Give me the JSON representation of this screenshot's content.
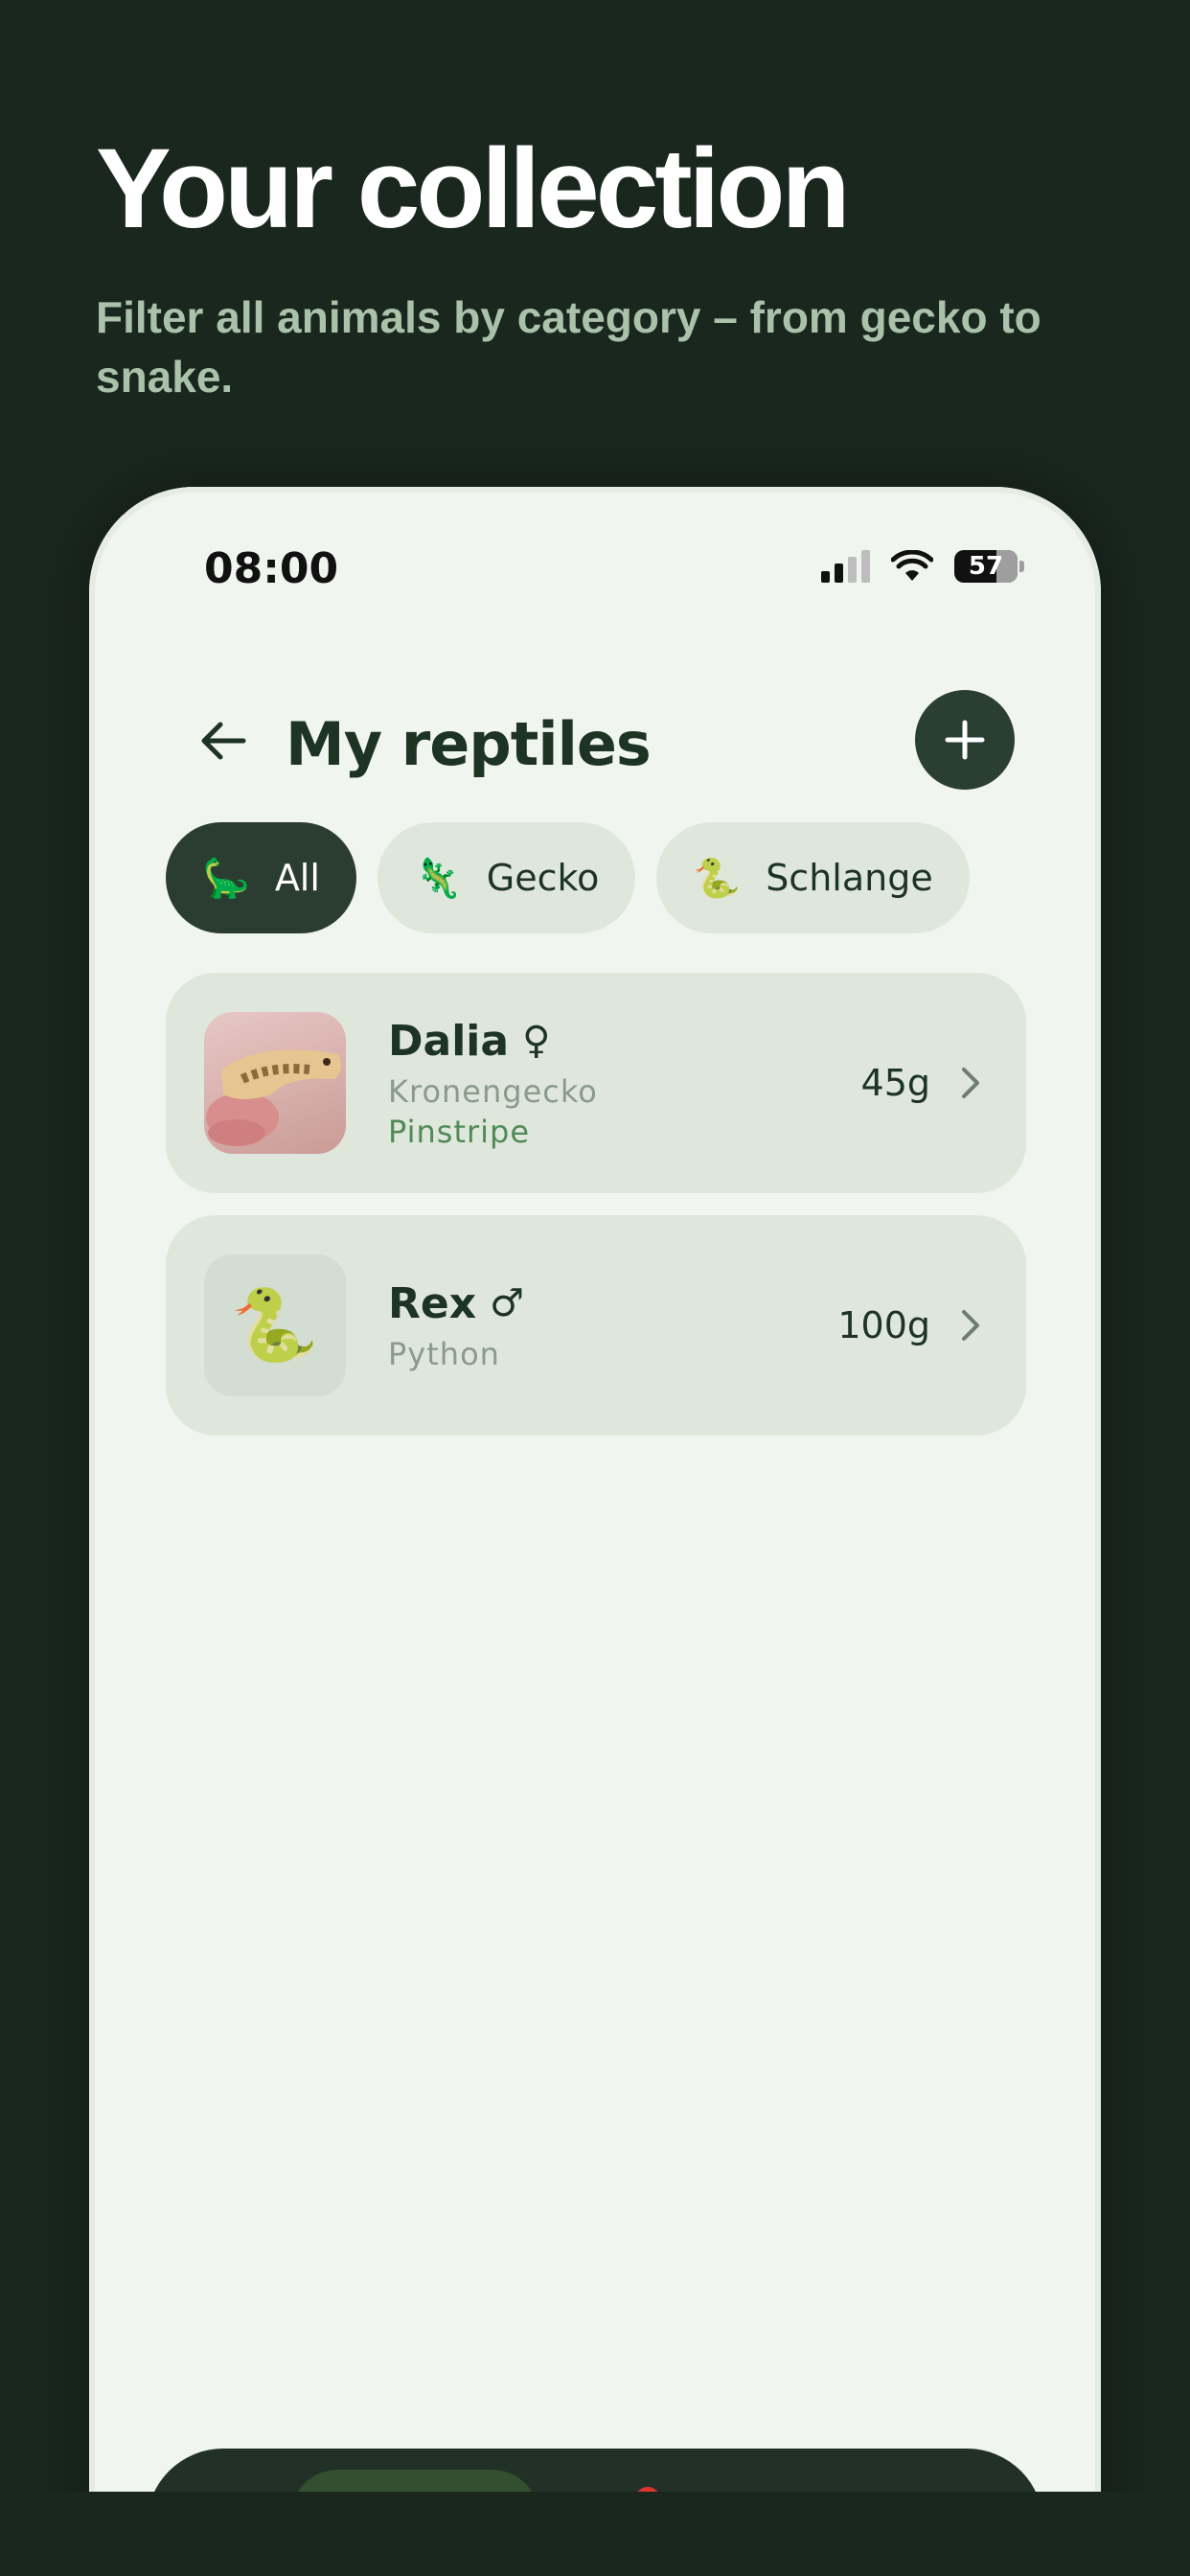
{
  "hero": {
    "title": "Your collection",
    "subtitle": "Filter all animals by category – from gecko to snake."
  },
  "status_bar": {
    "time": "08:00",
    "battery": "57"
  },
  "header": {
    "title": "My reptiles",
    "back_icon": "arrow-left-icon",
    "add_icon": "plus-icon"
  },
  "filters": [
    {
      "emoji": "🦕",
      "label": "All",
      "active": true
    },
    {
      "emoji": "🦎",
      "label": "Gecko",
      "active": false
    },
    {
      "emoji": "🐍",
      "label": "Schlange",
      "active": false
    }
  ],
  "animals": [
    {
      "name": "Dalia",
      "sex": "♀",
      "species": "Kronengecko",
      "morph": "Pinstripe",
      "weight": "45g",
      "thumb": "photo"
    },
    {
      "name": "Rex",
      "sex": "♂",
      "species": "Python",
      "morph": "",
      "weight": "100g",
      "thumb": "🐍"
    }
  ],
  "colors": {
    "background": "#19271f",
    "phone_screen": "#f1f5ef",
    "card": "#dfe7dc",
    "accent_dark": "#2b3d30",
    "morph_green": "#4f8a57"
  }
}
